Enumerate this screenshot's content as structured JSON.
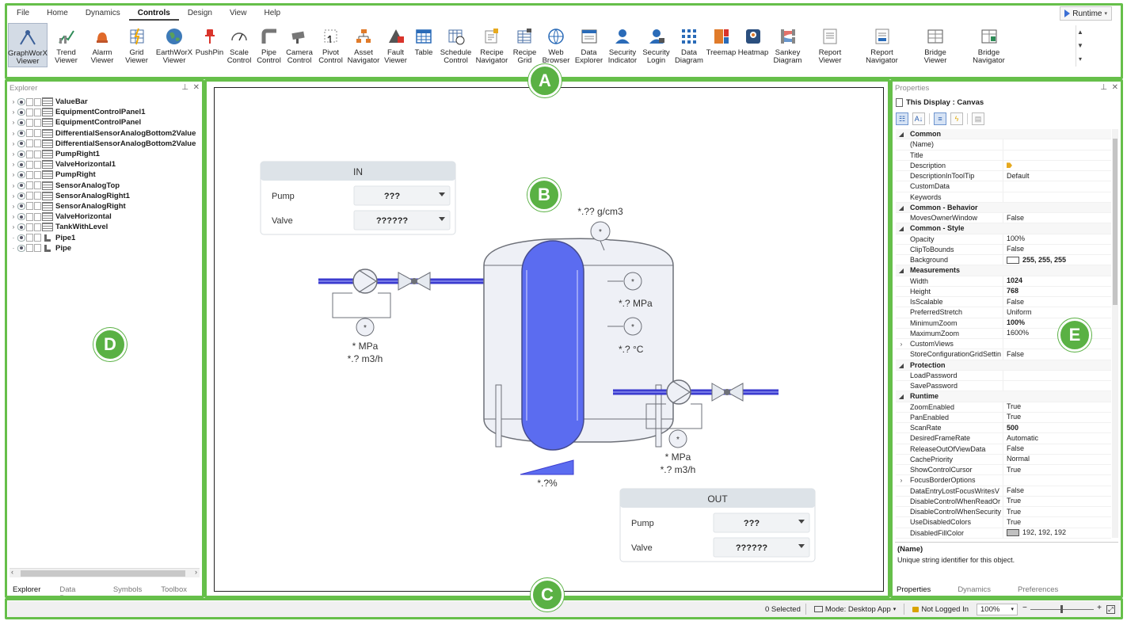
{
  "menu": [
    "File",
    "Home",
    "Dynamics",
    "Controls",
    "Design",
    "View",
    "Help"
  ],
  "runtime_button": "Runtime",
  "ribbon": [
    {
      "l1": "GraphWorX",
      "l2": "Viewer",
      "icon": "graphworx-viewer-icon",
      "selected": true
    },
    {
      "l1": "Trend",
      "l2": "Viewer",
      "icon": "trend-viewer-icon"
    },
    {
      "l1": "Alarm",
      "l2": "Viewer",
      "icon": "alarm-viewer-icon"
    },
    {
      "l1": "Grid",
      "l2": "Viewer",
      "icon": "grid-viewer-icon"
    },
    {
      "l1": "EarthWorX",
      "l2": "Viewer",
      "icon": "earthworx-viewer-icon"
    },
    {
      "l1": "PushPin",
      "l2": "",
      "icon": "pushpin-icon"
    },
    {
      "l1": "Scale",
      "l2": "Control",
      "icon": "scale-control-icon"
    },
    {
      "l1": "Pipe",
      "l2": "Control",
      "icon": "pipe-control-icon"
    },
    {
      "l1": "Camera",
      "l2": "Control",
      "icon": "camera-control-icon"
    },
    {
      "l1": "Pivot",
      "l2": "Control",
      "icon": "pivot-control-icon"
    },
    {
      "l1": "Asset",
      "l2": "Navigator",
      "icon": "asset-navigator-icon"
    },
    {
      "l1": "Fault",
      "l2": "Viewer",
      "icon": "fault-viewer-icon"
    },
    {
      "l1": "Table",
      "l2": "",
      "icon": "table-icon"
    },
    {
      "l1": "Schedule",
      "l2": "Control",
      "icon": "schedule-control-icon"
    },
    {
      "l1": "Recipe",
      "l2": "Navigator",
      "icon": "recipe-navigator-icon"
    },
    {
      "l1": "Recipe",
      "l2": "Grid",
      "icon": "recipe-grid-icon"
    },
    {
      "l1": "Web",
      "l2": "Browser",
      "icon": "web-browser-icon"
    },
    {
      "l1": "Data",
      "l2": "Explorer",
      "icon": "data-explorer-icon"
    },
    {
      "l1": "Security",
      "l2": "Indicator",
      "icon": "security-indicator-icon"
    },
    {
      "l1": "Security",
      "l2": "Login",
      "icon": "security-login-icon"
    },
    {
      "l1": "Data",
      "l2": "Diagram",
      "icon": "data-diagram-icon"
    },
    {
      "l1": "Treemap",
      "l2": "",
      "icon": "treemap-icon"
    },
    {
      "l1": "Heatmap",
      "l2": "",
      "icon": "heatmap-icon"
    },
    {
      "l1": "Sankey",
      "l2": "Diagram",
      "icon": "sankey-diagram-icon"
    },
    {
      "l1": "Report",
      "l2": "Viewer",
      "icon": "report-viewer-icon"
    },
    {
      "l1": "Report",
      "l2": "Navigator",
      "icon": "report-navigator-icon"
    },
    {
      "l1": "Bridge",
      "l2": "Viewer",
      "icon": "bridge-viewer-icon"
    },
    {
      "l1": "Bridge",
      "l2": "Navigator",
      "icon": "bridge-navigator-icon"
    }
  ],
  "callouts": {
    "a": "A",
    "b": "B",
    "c": "C",
    "d": "D",
    "e": "E"
  },
  "explorer": {
    "title": "Explorer",
    "items": [
      {
        "label": "ValueBar",
        "expandable": true,
        "kind": "shape"
      },
      {
        "label": "EquipmentControlPanel1",
        "expandable": true,
        "kind": "shape"
      },
      {
        "label": "EquipmentControlPanel",
        "expandable": true,
        "kind": "shape"
      },
      {
        "label": "DifferentialSensorAnalogBottom2Value",
        "expandable": true,
        "kind": "shape"
      },
      {
        "label": "DifferentialSensorAnalogBottom2Value",
        "expandable": true,
        "kind": "shape"
      },
      {
        "label": "PumpRight1",
        "expandable": true,
        "kind": "shape"
      },
      {
        "label": "ValveHorizontal1",
        "expandable": true,
        "kind": "shape"
      },
      {
        "label": "PumpRight",
        "expandable": true,
        "kind": "shape"
      },
      {
        "label": "SensorAnalogTop",
        "expandable": true,
        "kind": "shape"
      },
      {
        "label": "SensorAnalogRight1",
        "expandable": true,
        "kind": "shape"
      },
      {
        "label": "SensorAnalogRight",
        "expandable": true,
        "kind": "shape"
      },
      {
        "label": "ValveHorizontal",
        "expandable": true,
        "kind": "shape"
      },
      {
        "label": "TankWithLevel",
        "expandable": true,
        "kind": "shape"
      },
      {
        "label": "Pipe1",
        "expandable": false,
        "kind": "pipe"
      },
      {
        "label": "Pipe",
        "expandable": false,
        "kind": "pipe"
      }
    ],
    "tabs": [
      "Explorer",
      "Data Browser",
      "Symbols",
      "Toolbox"
    ]
  },
  "canvas": {
    "in_panel": {
      "title": "IN",
      "rows": [
        {
          "label": "Pump",
          "value": "???"
        },
        {
          "label": "Valve",
          "value": "??????"
        }
      ]
    },
    "out_panel": {
      "title": "OUT",
      "rows": [
        {
          "label": "Pump",
          "value": "???"
        },
        {
          "label": "Valve",
          "value": "??????"
        }
      ]
    },
    "density_label": "*.?? g/cm3",
    "tank_pressure_label": "*.? MPa",
    "tank_temp_label": "*.? °C",
    "inlet_pressure_label": "* MPa",
    "inlet_flow_label": "*.? m3/h",
    "outlet_pressure_label": "* MPa",
    "outlet_flow_label": "*.? m3/h",
    "level_label": "*.?%",
    "sensor_symbol": "*",
    "colors": {
      "pipe": "#3c3ccf",
      "liquid": "#5b6cf0",
      "tank_fill": "#eef0f6",
      "outline": "#6d7078"
    }
  },
  "properties": {
    "title": "Properties",
    "object": "This Display : Canvas",
    "rows": [
      {
        "cat": true,
        "name": "Common"
      },
      {
        "name": "(Name)",
        "value": ""
      },
      {
        "name": "Title",
        "value": ""
      },
      {
        "name": "Description",
        "value": "",
        "tag": true
      },
      {
        "name": "DescriptionInToolTip",
        "value": "Default"
      },
      {
        "name": "CustomData",
        "value": ""
      },
      {
        "name": "Keywords",
        "value": ""
      },
      {
        "cat": true,
        "name": "Common - Behavior"
      },
      {
        "name": "MovesOwnerWindow",
        "value": "False"
      },
      {
        "cat": true,
        "name": "Common - Style"
      },
      {
        "name": "Opacity",
        "value": "100%"
      },
      {
        "name": "ClipToBounds",
        "value": "False"
      },
      {
        "name": "Background",
        "value": "255, 255, 255",
        "swatch": "#ffffff",
        "bold": true
      },
      {
        "cat": true,
        "name": "Measurements"
      },
      {
        "name": "Width",
        "value": "1024",
        "bold": true
      },
      {
        "name": "Height",
        "value": "768",
        "bold": true
      },
      {
        "name": "IsScalable",
        "value": "False"
      },
      {
        "name": "PreferredStretch",
        "value": "Uniform"
      },
      {
        "name": "MinimumZoom",
        "value": "100%",
        "bold": true
      },
      {
        "name": "MaximumZoom",
        "value": "1600%"
      },
      {
        "name": "CustomViews",
        "value": "",
        "expand": true
      },
      {
        "name": "StoreConfigurationGridSettin",
        "value": "False"
      },
      {
        "cat": true,
        "name": "Protection"
      },
      {
        "name": "LoadPassword",
        "value": ""
      },
      {
        "name": "SavePassword",
        "value": ""
      },
      {
        "cat": true,
        "name": "Runtime"
      },
      {
        "name": "ZoomEnabled",
        "value": "True"
      },
      {
        "name": "PanEnabled",
        "value": "True"
      },
      {
        "name": "ScanRate",
        "value": "500",
        "bold": true
      },
      {
        "name": "DesiredFrameRate",
        "value": "Automatic"
      },
      {
        "name": "ReleaseOutOfViewData",
        "value": "False"
      },
      {
        "name": "CachePriority",
        "value": "Normal"
      },
      {
        "name": "ShowControlCursor",
        "value": "True"
      },
      {
        "name": "FocusBorderOptions",
        "value": "",
        "expand": true
      },
      {
        "name": "DataEntryLostFocusWritesV",
        "value": "False"
      },
      {
        "name": "DisableControlWhenReadOr",
        "value": "True"
      },
      {
        "name": "DisableControlWhenSecurity",
        "value": "True"
      },
      {
        "name": "UseDisabledColors",
        "value": "True"
      },
      {
        "name": "DisabledFillColor",
        "value": "192, 192, 192",
        "swatch": "#c0c0c0"
      }
    ],
    "desc_title": "(Name)",
    "desc_text": "Unique string identifier for this object.",
    "tabs": [
      "Properties",
      "Dynamics",
      "Preferences"
    ]
  },
  "status": {
    "selected": "0 Selected",
    "mode": "Mode: Desktop App",
    "login": "Not Logged In",
    "zoom": "100%"
  },
  "accent_green": "#5ab144"
}
